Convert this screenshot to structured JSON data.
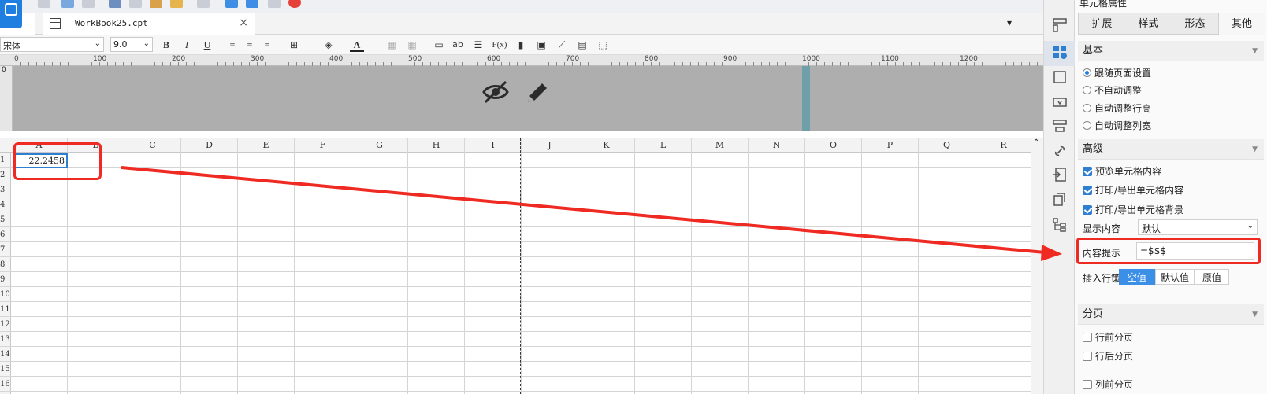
{
  "document": {
    "tab_name": "WorkBook25.cpt",
    "close_symbol": "×"
  },
  "format_bar": {
    "font_name": "宋体",
    "font_size": "9.0",
    "bold": "B",
    "italic": "I",
    "underline": "U",
    "text_color_glyph": "A",
    "ab_glyph": "ab",
    "formula_glyph": "F(x)"
  },
  "ruler": {
    "labels": [
      "0",
      "100",
      "200",
      "300",
      "400",
      "500",
      "600",
      "700",
      "800",
      "900",
      "1000",
      "1100",
      "1200"
    ],
    "vertical_label": "0"
  },
  "grid": {
    "columns": [
      "A",
      "B",
      "C",
      "D",
      "E",
      "F",
      "G",
      "H",
      "I",
      "J",
      "K",
      "L",
      "M",
      "N",
      "O",
      "P",
      "Q",
      "R"
    ],
    "rows": [
      "1",
      "2",
      "3",
      "4",
      "5",
      "6",
      "7",
      "8",
      "9",
      "10",
      "11",
      "12",
      "13",
      "14",
      "15",
      "16"
    ],
    "cell_A1": "22.2458"
  },
  "panel": {
    "title": "单元格属性",
    "tabs": [
      "扩展",
      "样式",
      "形态",
      "其他"
    ],
    "active_tab": "其他",
    "sections": {
      "basic": "基本",
      "advanced": "高级",
      "paging": "分页"
    },
    "basic_options": [
      {
        "label": "跟随页面设置",
        "selected": true
      },
      {
        "label": "不自动调整",
        "selected": false
      },
      {
        "label": "自动调整行高",
        "selected": false
      },
      {
        "label": "自动调整列宽",
        "selected": false
      }
    ],
    "advanced_checks": [
      {
        "label": "预览单元格内容",
        "checked": true
      },
      {
        "label": "打印/导出单元格内容",
        "checked": true
      },
      {
        "label": "打印/导出单元格背景",
        "checked": true
      }
    ],
    "display_content_label": "显示内容",
    "display_content_value": "默认",
    "content_tip_label": "内容提示",
    "content_tip_value": "=$$$",
    "insert_policy_label": "插入行策略",
    "insert_policy_options": [
      "空值",
      "默认值",
      "原值"
    ],
    "insert_policy_selected": "空值",
    "paging_checks": [
      {
        "label": "行前分页",
        "checked": false
      },
      {
        "label": "行后分页",
        "checked": false
      },
      {
        "label": "列前分页",
        "checked": false
      }
    ]
  },
  "colors": {
    "accent": "#1e7fe0",
    "annotation": "#ef2a22"
  }
}
